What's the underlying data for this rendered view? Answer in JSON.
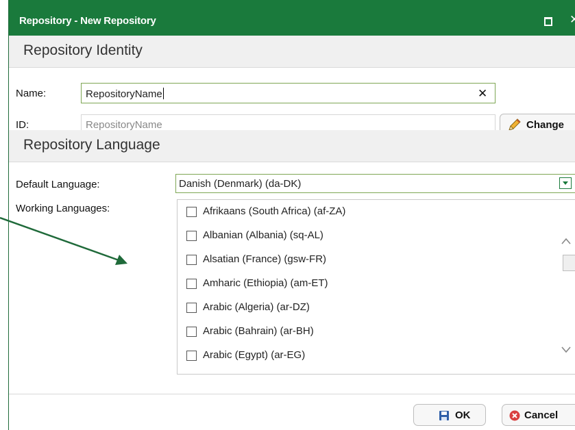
{
  "window": {
    "title": "Repository - New Repository",
    "maximize_icon": "maximize-icon",
    "close_icon": "close-icon"
  },
  "sections": {
    "identity": "Repository Identity",
    "language": "Repository Language"
  },
  "identity": {
    "name_label": "Name:",
    "name_value": "RepositoryName",
    "id_label": "ID:",
    "id_value": "RepositoryName",
    "change_label": "Change"
  },
  "language": {
    "default_label": "Default Language:",
    "default_value": "Danish (Denmark) (da-DK)",
    "working_label": "Working Languages:",
    "working_items": [
      {
        "label": "Afrikaans (South Africa) (af-ZA)",
        "checked": false
      },
      {
        "label": "Albanian (Albania) (sq-AL)",
        "checked": false
      },
      {
        "label": "Alsatian (France) (gsw-FR)",
        "checked": false
      },
      {
        "label": "Amharic (Ethiopia) (am-ET)",
        "checked": false
      },
      {
        "label": "Arabic (Algeria) (ar-DZ)",
        "checked": false
      },
      {
        "label": "Arabic (Bahrain) (ar-BH)",
        "checked": false
      },
      {
        "label": "Arabic (Egypt) (ar-EG)",
        "checked": false
      }
    ]
  },
  "footer": {
    "ok_label": "OK",
    "cancel_label": "Cancel"
  },
  "colors": {
    "titlebar": "#1a7a3c",
    "accent_border": "#7da653",
    "arrow": "#1f6a3a"
  }
}
